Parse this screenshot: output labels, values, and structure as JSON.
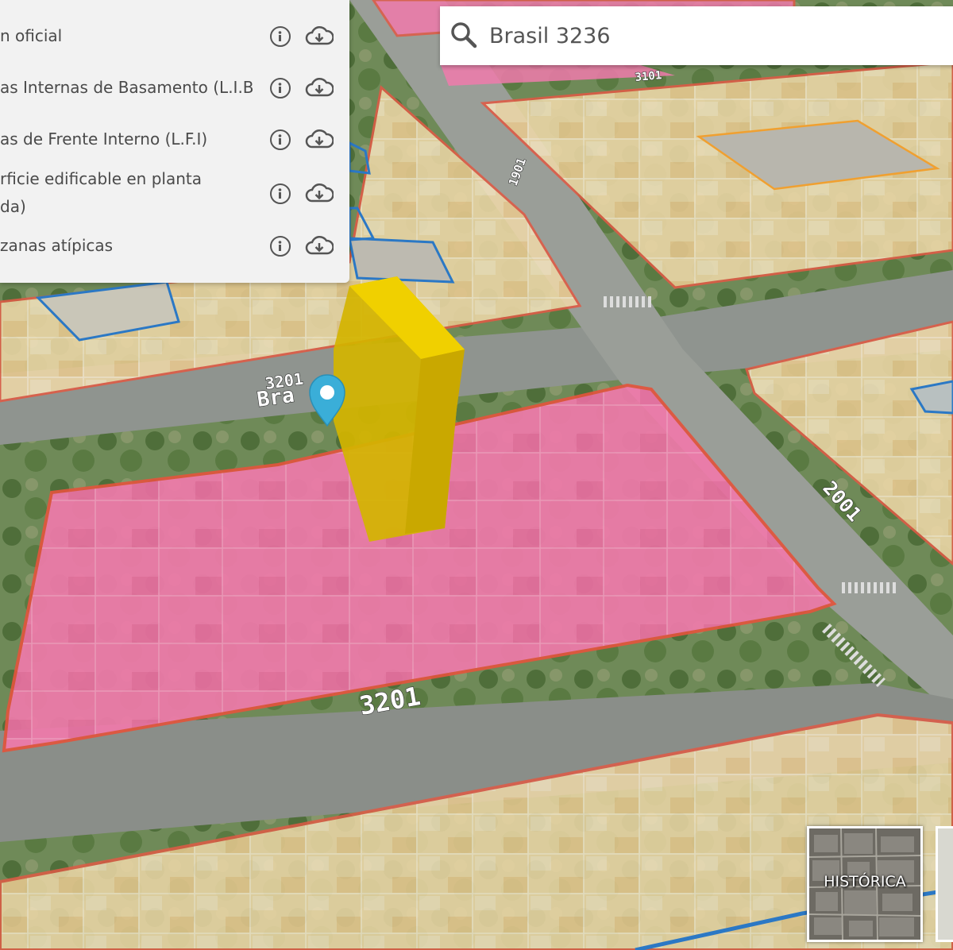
{
  "layers": [
    {
      "label_lines": [
        "n oficial"
      ]
    },
    {
      "label_lines": [
        "as Internas de Basamento (L.I.B)"
      ]
    },
    {
      "label_lines": [
        "as de Frente Interno (L.F.I)"
      ]
    },
    {
      "label_lines": [
        "rficie edificable en planta",
        "da)"
      ]
    },
    {
      "label_lines": [
        "zanas atípicas"
      ]
    }
  ],
  "search": {
    "value": "Brasil 3236"
  },
  "streets": {
    "s1": "3201",
    "s2": "3201",
    "s3": "2001",
    "s4": "1901",
    "s5": "3101",
    "s6": "Bra"
  },
  "basemap": {
    "label": "HISTÓRICA"
  },
  "colors": {
    "highlight_block": "#f07aab",
    "highlight_outline": "#e2553c",
    "block_outline": "#e05a45",
    "lot_outline": "#2b78c5",
    "building_volume": "#e6c200",
    "marker": "#3aaed8",
    "city_block": "#f0ddb0"
  },
  "icons": {
    "info": "info-icon",
    "download": "cloud-download-icon",
    "search": "search-icon",
    "marker": "location-pin-icon"
  }
}
